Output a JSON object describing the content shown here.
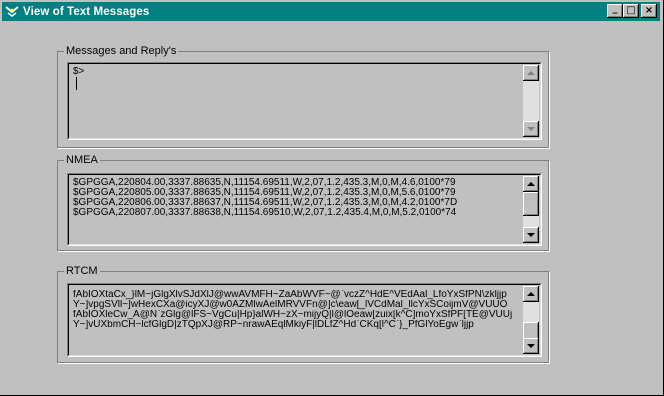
{
  "window": {
    "title": "View of Text Messages",
    "controls": {
      "minimize": "_",
      "maximize": "□",
      "close": "×"
    }
  },
  "groups": {
    "messages": {
      "label": "Messages and Reply's",
      "text": "$>"
    },
    "nmea": {
      "label": "NMEA",
      "lines": [
        "$GPGGA,220804.00,3337.88635,N,11154.69511,W,2,07,1.2,435.3,M,0,M,4.6,0100*79",
        "$GPGGA,220805.00,3337.88635,N,11154.69511,W,2,07,1.2,435.3,M,0,M,5.6,0100*79",
        "$GPGGA,220806.00,3337.88637,N,11154.69511,W,2,07,1.2,435.3,M,0,M,4.2,0100*7D",
        "$GPGGA,220807.00,3337.88638,N,11154.69510,W,2,07,1.2,435.4,M,0,M,5.2,0100*74"
      ]
    },
    "rtcm": {
      "label": "RTCM",
      "lines": [
        "fAbIOXtaCx_}lM~jGlgXlvSJdXlJ@wwAVMFH~ZaAbWVF~@`vczZ^HdE^VEdAal_LfoYxSfPN\\zkljjp",
        "Y~]vpgSVll~]wHexCXa@icyXJ@w0AZMlwAelMRVVFn@]c\\eaw[_lVCdMal_llcYxSCoijmV@VUUO",
        "fAbIOXleCw_A@N`zGlg@lFS~VgCu|Hp}alWH~zX~mijyQ|l@lOeaw[zuix[k^C]moYxSfPF[TE@VUUj",
        "Y~]vUXbmCH~lcfGlgD|zTQpXJ@RP~nrawAEqlMkiyF|lDLfZ^Hd`CKq[l^C`}_PfGlYoEgw`ljjp"
      ]
    }
  },
  "colors": {
    "titlebar": "#008080",
    "face": "#c0c0c0"
  }
}
